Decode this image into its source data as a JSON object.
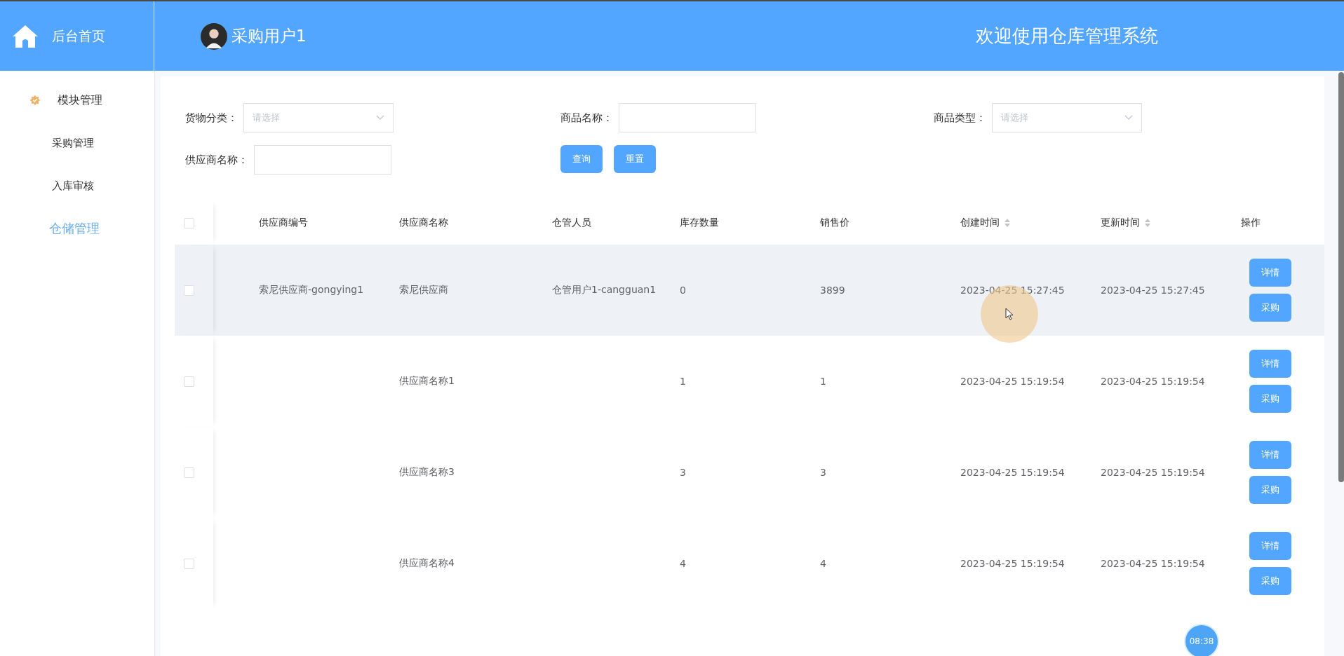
{
  "header": {
    "home_label": "后台首页",
    "user_name": "采购用户1",
    "welcome": "欢迎使用仓库管理系统"
  },
  "sidebar": {
    "items": [
      {
        "kind": "group",
        "label": "模块管理",
        "selected": false
      },
      {
        "kind": "item",
        "label": "采购管理",
        "selected": false
      },
      {
        "kind": "item",
        "label": "入库审核",
        "selected": false
      },
      {
        "kind": "item",
        "label": "仓储管理",
        "selected": true
      }
    ]
  },
  "filters": [
    {
      "kind": "select",
      "label": "货物分类：",
      "placeholder": "请选择"
    },
    {
      "kind": "input",
      "label": "商品名称："
    },
    {
      "kind": "select",
      "label": "商品类型：",
      "placeholder": "请选择"
    },
    {
      "kind": "input",
      "label": "供应商名称："
    }
  ],
  "filter_buttons": [
    "查询",
    "重置"
  ],
  "table": {
    "select_all_checked": false,
    "columns": [
      {
        "label": "供应商编号",
        "sortable": false
      },
      {
        "label": "供应商名称",
        "sortable": false
      },
      {
        "label": "仓管人员",
        "sortable": false
      },
      {
        "label": "库存数量",
        "sortable": false
      },
      {
        "label": "销售价",
        "sortable": false
      },
      {
        "label": "创建时间",
        "sortable": true
      },
      {
        "label": "更新时间",
        "sortable": true
      },
      {
        "label": "操作",
        "sortable": false
      }
    ],
    "rows": [
      {
        "checked": false,
        "hovered": true,
        "cells": [
          "索尼供应商-gongying1",
          "索尼供应商",
          "仓管用户1-cangguan1",
          "0",
          "3899",
          "2023-04-25 15:27:45",
          "2023-04-25 15:27:45"
        ],
        "actions": [
          "详情",
          "采购"
        ]
      },
      {
        "checked": false,
        "hovered": false,
        "cells": [
          "",
          "供应商名称1",
          "",
          "1",
          "1",
          "2023-04-25 15:19:54",
          "2023-04-25 15:19:54"
        ],
        "actions": [
          "详情",
          "采购"
        ]
      },
      {
        "checked": false,
        "hovered": false,
        "cells": [
          "",
          "供应商名称3",
          "",
          "3",
          "3",
          "2023-04-25 15:19:54",
          "2023-04-25 15:19:54"
        ],
        "actions": [
          "详情",
          "采购"
        ]
      },
      {
        "checked": false,
        "hovered": false,
        "cells": [
          "",
          "供应商名称4",
          "",
          "4",
          "4",
          "2023-04-25 15:19:54",
          "2023-04-25 15:19:54"
        ],
        "actions": [
          "详情",
          "采购"
        ]
      }
    ]
  },
  "timer_badge": "08:38"
}
